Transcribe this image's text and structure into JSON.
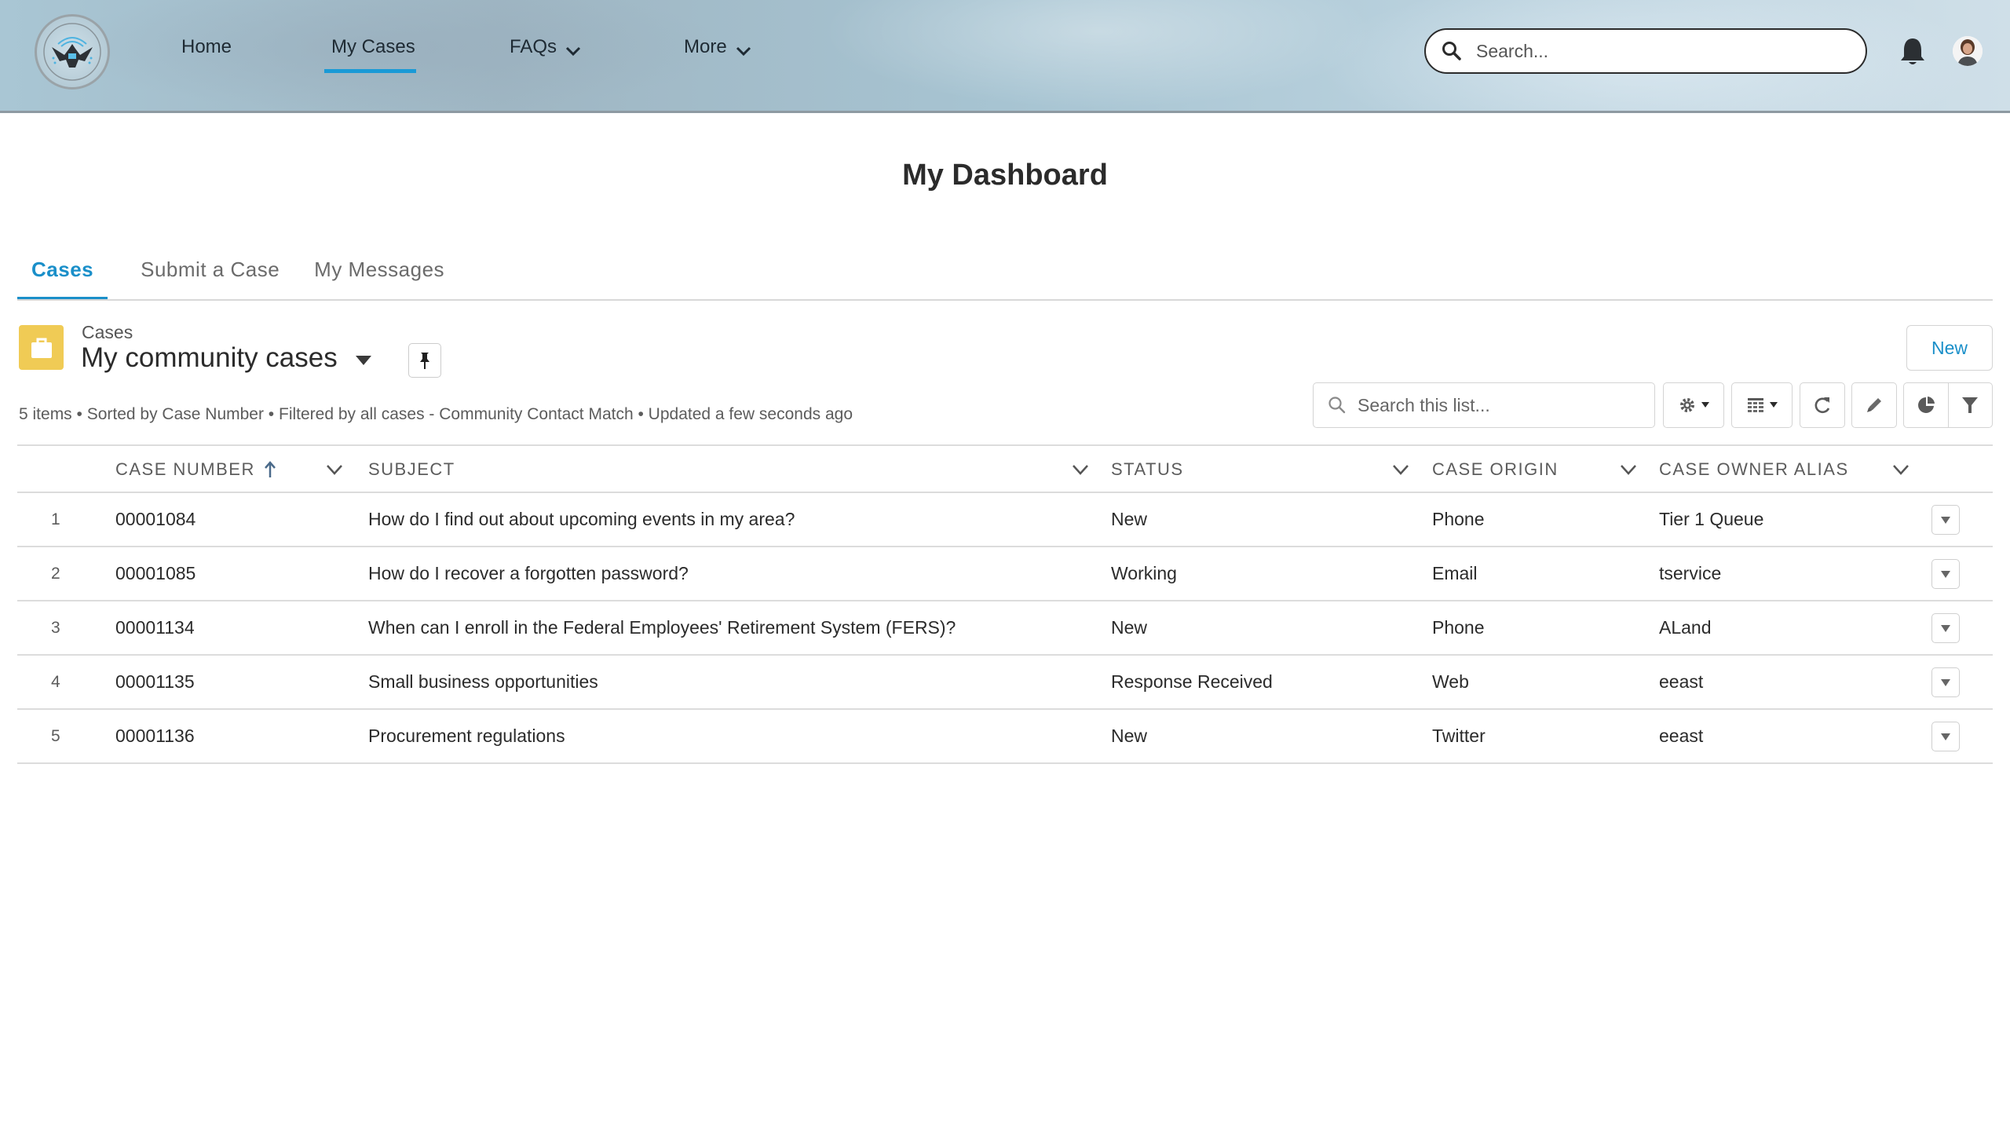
{
  "header": {
    "logo_alt": "Department of the Future seal",
    "nav": [
      {
        "label": "Home",
        "active": false,
        "has_dropdown": false
      },
      {
        "label": "My Cases",
        "active": true,
        "has_dropdown": false
      },
      {
        "label": "FAQs",
        "active": false,
        "has_dropdown": true
      },
      {
        "label": "More",
        "active": false,
        "has_dropdown": true
      }
    ],
    "search_placeholder": "Search...",
    "icons": {
      "search": "search-icon",
      "notifications": "bell-icon",
      "avatar": "user-avatar"
    },
    "accent_color": "#1a9ad6"
  },
  "page": {
    "title": "My Dashboard"
  },
  "tabs": [
    {
      "label": "Cases",
      "active": true
    },
    {
      "label": "Submit a Case",
      "active": false
    },
    {
      "label": "My Messages",
      "active": false
    }
  ],
  "list_view": {
    "object_label": "Cases",
    "object_icon": "case-briefcase-icon",
    "object_icon_color": "#f0cb55",
    "title": "My community cases",
    "meta": "5 items • Sorted by Case Number • Filtered by all cases - Community Contact Match • Updated a few seconds ago",
    "new_button_label": "New",
    "search_placeholder": "Search this list...",
    "toolbar_icons": [
      "gear-icon",
      "table-icon",
      "refresh-icon",
      "pencil-icon",
      "pie-chart-icon",
      "filter-icon"
    ],
    "columns": [
      {
        "label": "CASE NUMBER",
        "sorted": "ascending"
      },
      {
        "label": "SUBJECT"
      },
      {
        "label": "STATUS"
      },
      {
        "label": "CASE ORIGIN"
      },
      {
        "label": "CASE OWNER ALIAS"
      }
    ],
    "rows": [
      {
        "index": "1",
        "case_number": "00001084",
        "subject": "How do I find out about upcoming events in my area?",
        "status": "New",
        "origin": "Phone",
        "owner": "Tier 1 Queue"
      },
      {
        "index": "2",
        "case_number": "00001085",
        "subject": "How do I recover a forgotten password?",
        "status": "Working",
        "origin": "Email",
        "owner": "tservice"
      },
      {
        "index": "3",
        "case_number": "00001134",
        "subject": "When can I enroll in the Federal Employees' Retirement System (FERS)?",
        "status": "New",
        "origin": "Phone",
        "owner": "ALand"
      },
      {
        "index": "4",
        "case_number": "00001135",
        "subject": "Small business opportunities",
        "status": "Response Received",
        "origin": "Web",
        "owner": "eeast"
      },
      {
        "index": "5",
        "case_number": "00001136",
        "subject": "Procurement regulations",
        "status": "New",
        "origin": "Twitter",
        "owner": "eeast"
      }
    ]
  }
}
